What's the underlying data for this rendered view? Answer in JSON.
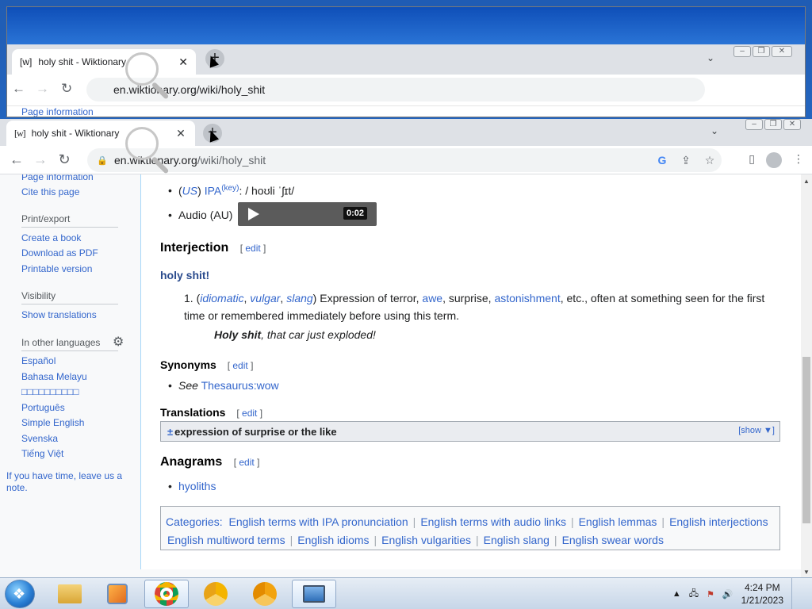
{
  "back_window": {
    "tab_title": "holy shit - Wiktionary",
    "url": "en.wiktionary.org/wiki/holy_shit",
    "peek_link": "Page information"
  },
  "browser": {
    "favicon": "[w]",
    "tab_title": "holy shit - Wiktionary",
    "new_tab": "+",
    "url_host": "en.wiktionary.org",
    "url_path": "/wiki/holy_shit"
  },
  "sidebar": {
    "page_information": "Page information",
    "cite": "Cite this page",
    "print_heading": "Print/export",
    "create_book": "Create a book",
    "download_pdf": "Download as PDF",
    "printable": "Printable version",
    "visibility_heading": "Visibility",
    "show_translations": "Show translations",
    "languages_heading": "In other languages",
    "languages": [
      "Español",
      "Bahasa Melayu",
      "□□□□□□□□□□",
      "Português",
      "Simple English",
      "Svenska",
      "Tiếng Việt"
    ],
    "note": "If you have time, leave us a note."
  },
  "pronunciation": {
    "us_label": "US",
    "ipa_label": "IPA",
    "key_label": "(key)",
    "ipa_text": ": / hoʊli ˈʃɪt/",
    "audio_label": "Audio (AU)",
    "audio_time": "0:02"
  },
  "interjection": {
    "heading": "Interjection",
    "edit": "edit",
    "headword": "holy shit!",
    "def_number": "1.",
    "labels": [
      "idiomatic",
      "vulgar",
      "slang"
    ],
    "def_text_1": "Expression of terror, ",
    "def_link_awe": "awe",
    "def_text_2": ", surprise, ",
    "def_link_astonishment": "astonishment",
    "def_text_3": ", etc., often at something seen for the first time or remembered immediately before using this term.",
    "example_bold": "Holy shit",
    "example_rest": ", that car just exploded!"
  },
  "synonyms": {
    "heading": "Synonyms",
    "edit": "edit",
    "see": "See",
    "link": "Thesaurus:wow"
  },
  "translations": {
    "heading": "Translations",
    "edit": "edit",
    "toggle": "±",
    "gloss": "expression of surprise or the like",
    "show": "[show ▼]"
  },
  "anagrams": {
    "heading": "Anagrams",
    "edit": "edit",
    "items": [
      "hyoliths"
    ]
  },
  "categories": {
    "label": "Categories:",
    "row1": [
      "English terms with IPA pronunciation",
      "English terms with audio links",
      "English lemmas",
      "English interjections"
    ],
    "row2": [
      "English multiword terms",
      "English idioms",
      "English vulgarities",
      "English slang",
      "English swear words"
    ]
  },
  "taskbar": {
    "time": "4:24 PM",
    "date": "1/21/2023",
    "apps": [
      "explorer-icon",
      "media-player-icon",
      "chrome-icon",
      "chrome-canary-icon",
      "chrome-beta-icon",
      "remote-desktop-icon"
    ]
  }
}
